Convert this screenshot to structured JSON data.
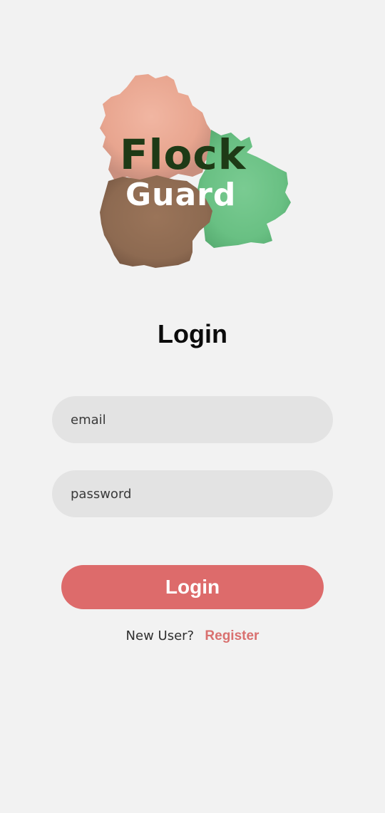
{
  "logo": {
    "word1": "Flock",
    "word2": "Guard"
  },
  "page": {
    "title": "Login"
  },
  "form": {
    "email_placeholder": "email",
    "email_value": "",
    "password_placeholder": "password",
    "password_value": "",
    "submit_label": "Login"
  },
  "register": {
    "prompt": "New User?",
    "link_label": "Register"
  },
  "colors": {
    "background": "#f2f2f2",
    "field_background": "#e3e3e3",
    "accent": "#dd6b6b",
    "logo_pink": "#e9a895",
    "logo_brown": "#8f6a52",
    "logo_green": "#6cc286",
    "logo_text_dark": "#1e3a16"
  }
}
